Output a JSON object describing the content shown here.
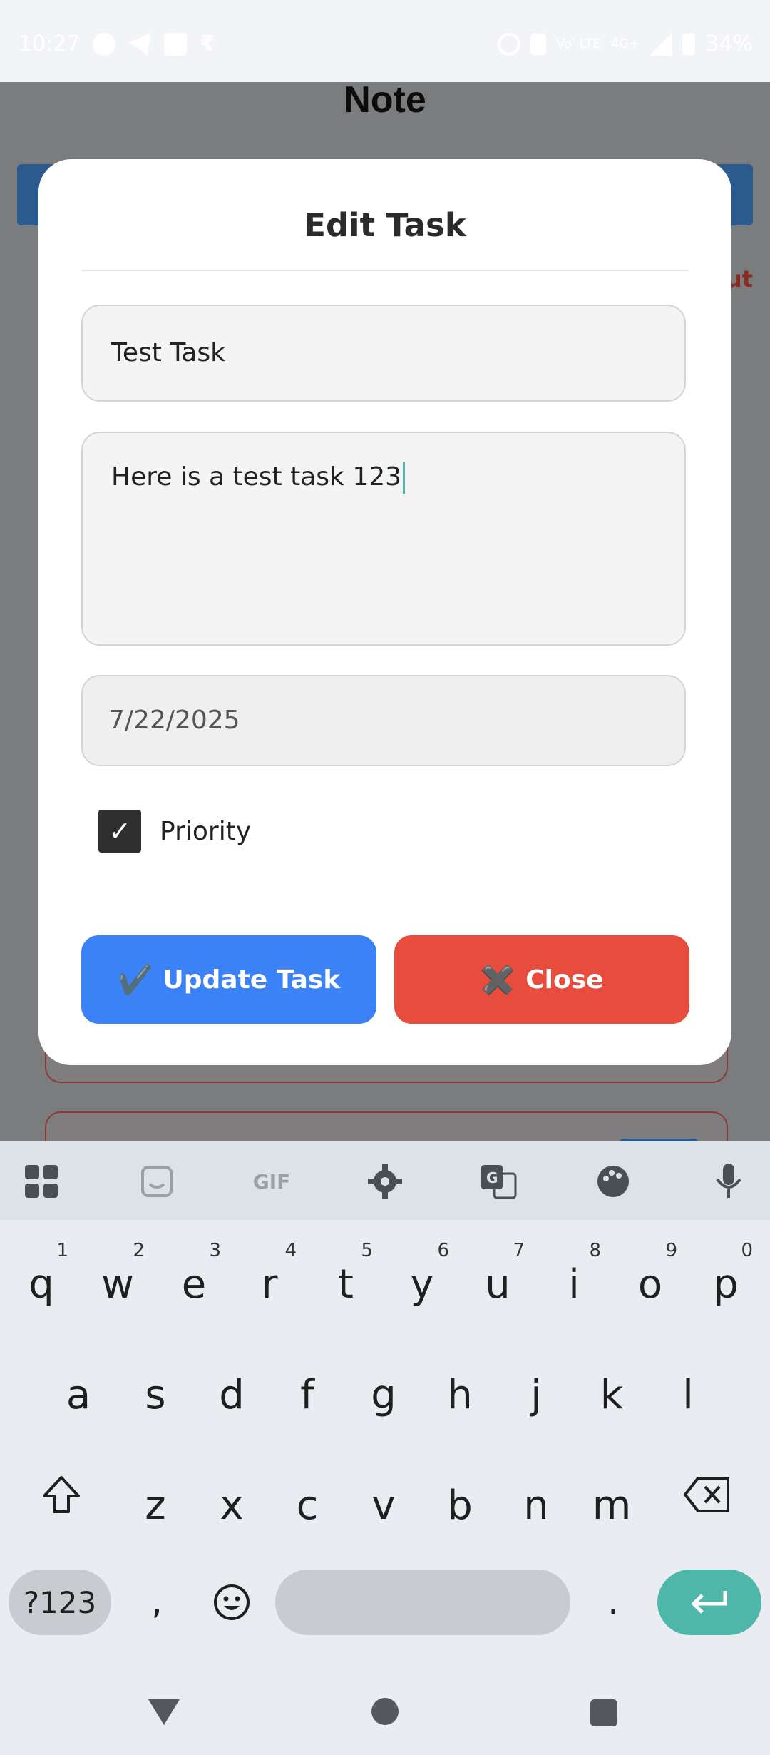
{
  "status_bar": {
    "time": "10:27",
    "network_label": "4G+",
    "volte_label": "Voʹ LTE",
    "battery_label": "34%"
  },
  "app": {
    "title": "Note",
    "background_logout_fragment": "ut"
  },
  "modal": {
    "title": "Edit Task",
    "task_title_value": "Test Task",
    "task_description_value": "Here is a test task 123",
    "due_date_value": "7/22/2025",
    "priority_label": "Priority",
    "priority_checked": true,
    "checkbox_glyph": "✓",
    "update_button_label": "Update Task",
    "update_button_icon": "✔️",
    "close_button_label": "Close",
    "close_button_icon": "✖️",
    "colors": {
      "update": "#3b82f6",
      "close": "#e74c3c"
    }
  },
  "keyboard": {
    "toolbar_icons": [
      "apps-grid-icon",
      "sticker-icon",
      "gif-icon",
      "settings-gear-icon",
      "translate-icon",
      "palette-icon",
      "microphone-icon"
    ],
    "gif_label": "GIF",
    "row1": [
      {
        "key": "q",
        "hint": "1"
      },
      {
        "key": "w",
        "hint": "2"
      },
      {
        "key": "e",
        "hint": "3"
      },
      {
        "key": "r",
        "hint": "4"
      },
      {
        "key": "t",
        "hint": "5"
      },
      {
        "key": "y",
        "hint": "6"
      },
      {
        "key": "u",
        "hint": "7"
      },
      {
        "key": "i",
        "hint": "8"
      },
      {
        "key": "o",
        "hint": "9"
      },
      {
        "key": "p",
        "hint": "0"
      }
    ],
    "row2": [
      "a",
      "s",
      "d",
      "f",
      "g",
      "h",
      "j",
      "k",
      "l"
    ],
    "row3": [
      "z",
      "x",
      "c",
      "v",
      "b",
      "n",
      "m"
    ],
    "symbols_key": "?123",
    "comma_key": ",",
    "period_key": ".",
    "emoji_icon": "emoji-icon",
    "shift_icon": "shift-icon",
    "backspace_icon": "backspace-icon",
    "enter_icon": "enter-icon",
    "enter_color": "#4fb7aa"
  },
  "navbar": {
    "back_icon": "back-triangle-icon",
    "home_icon": "home-circle-icon",
    "recents_icon": "recents-square-icon"
  }
}
